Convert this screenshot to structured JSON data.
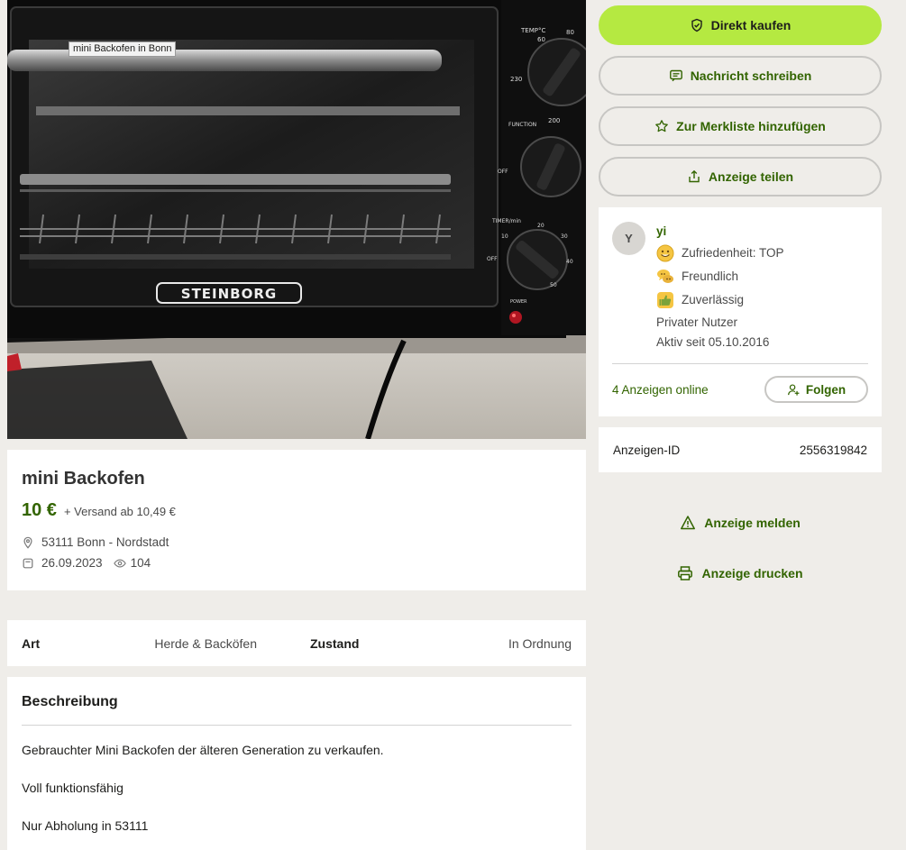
{
  "photo": {
    "caption": "mini Backofen in Bonn",
    "brand": "STEINBORG",
    "knob_labels": {
      "temp": "TEMP°C",
      "function": "FUNCTION",
      "timer": "TIMER/min",
      "power": "POWER",
      "off": "OFF",
      "t60": "60",
      "t80": "80",
      "t200": "200",
      "t230": "230",
      "m10": "10",
      "m20": "20",
      "m30": "30",
      "m40": "40",
      "m50": "50"
    }
  },
  "listing": {
    "title": "mini Backofen",
    "price": "10 €",
    "shipping": "+ Versand ab 10,49 €",
    "location": "53111 Bonn - Nordstadt",
    "date": "26.09.2023",
    "views": "104"
  },
  "details": [
    {
      "label": "Art",
      "value": "Herde & Backöfen"
    },
    {
      "label": "Zustand",
      "value": "In Ordnung"
    }
  ],
  "description": {
    "heading": "Beschreibung",
    "paragraphs": [
      "Gebrauchter Mini Backofen der älteren Generation zu verkaufen.",
      "Voll funktionsfähig",
      "Nur Abholung in 53111"
    ]
  },
  "actions": {
    "buy": "Direkt kaufen",
    "message": "Nachricht schreiben",
    "watchlist": "Zur Merkliste hinzufügen",
    "share": "Anzeige teilen",
    "report": "Anzeige melden",
    "print": "Anzeige drucken"
  },
  "seller": {
    "initial": "Y",
    "name": "yi",
    "badges": [
      {
        "label": "Zufriedenheit: TOP",
        "icon": "smiley-icon"
      },
      {
        "label": "Freundlich",
        "icon": "speech-bubbles-icon"
      },
      {
        "label": "Zuverlässig",
        "icon": "thumbs-up-icon"
      }
    ],
    "type": "Privater Nutzer",
    "active_since": "Aktiv seit 05.10.2016",
    "ads_online": "4 Anzeigen online",
    "follow": "Folgen"
  },
  "ad_id": {
    "label": "Anzeigen-ID",
    "value": "2556319842"
  },
  "colors": {
    "accent_green": "#326400",
    "primary_button": "#b5e941",
    "page_bg": "#efede9"
  }
}
